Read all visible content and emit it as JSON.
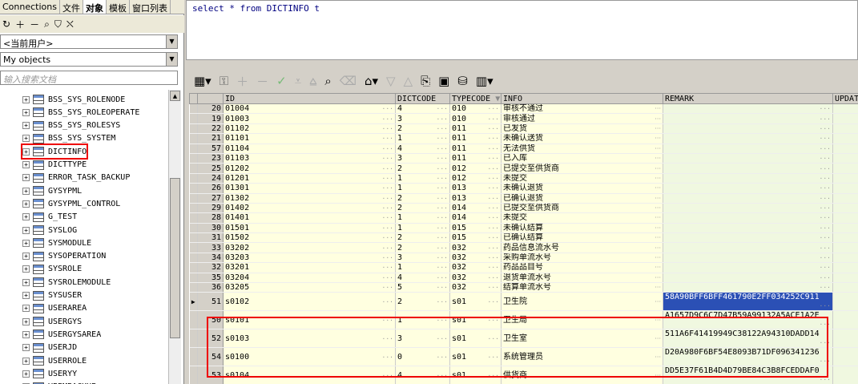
{
  "left_panel": {
    "tabs": [
      "Connections",
      "文件",
      "对象",
      "模板",
      "窗口列表"
    ],
    "active_tab": "对象",
    "user_select": "<当前用户>",
    "objects_select": "My objects",
    "search_placeholder": "输入搜索文档",
    "tree_items": [
      "BSS_SYS_ROLENODE",
      "BSS_SYS_ROLEOPERATE",
      "BSS_SYS_ROLESYS",
      "BSS_SYS_SYSTEM",
      "DICTINFO",
      "DICTTYPE",
      "ERROR_TASK_BACKUP",
      "GYSYPML",
      "GYSYPML_CONTROL",
      "G_TEST",
      "SYSLOG",
      "SYSMODULE",
      "SYSOPERATION",
      "SYSROLE",
      "SYSROLEMODULE",
      "SYSUSER",
      "USERAREA",
      "USERGYS",
      "USERGYSAREA",
      "USERJD",
      "USERROLE",
      "USERYY",
      "YPPMBACKUP"
    ],
    "selected_item": "DICTINFO"
  },
  "editor": {
    "sql": "select * from DICTINFO t"
  },
  "grid": {
    "columns": [
      "ID",
      "DICTCODE",
      "TYPECODE",
      "INFO",
      "REMARK",
      "UPDAT"
    ],
    "rows": [
      {
        "n": "20",
        "id": "01004",
        "dc": "4",
        "tc": "010",
        "info": "审核不通过",
        "remark": ""
      },
      {
        "n": "19",
        "id": "01003",
        "dc": "3",
        "tc": "010",
        "info": "审核通过",
        "remark": ""
      },
      {
        "n": "22",
        "id": "01102",
        "dc": "2",
        "tc": "011",
        "info": "已发货",
        "remark": ""
      },
      {
        "n": "21",
        "id": "01101",
        "dc": "1",
        "tc": "011",
        "info": "未确认送货",
        "remark": ""
      },
      {
        "n": "57",
        "id": "01104",
        "dc": "4",
        "tc": "011",
        "info": "无法供货",
        "remark": ""
      },
      {
        "n": "23",
        "id": "01103",
        "dc": "3",
        "tc": "011",
        "info": "已入库",
        "remark": ""
      },
      {
        "n": "25",
        "id": "01202",
        "dc": "2",
        "tc": "012",
        "info": "已提交至供货商",
        "remark": ""
      },
      {
        "n": "24",
        "id": "01201",
        "dc": "1",
        "tc": "012",
        "info": "未提交",
        "remark": ""
      },
      {
        "n": "26",
        "id": "01301",
        "dc": "1",
        "tc": "013",
        "info": "未确认退货",
        "remark": ""
      },
      {
        "n": "27",
        "id": "01302",
        "dc": "2",
        "tc": "013",
        "info": "已确认退货",
        "remark": ""
      },
      {
        "n": "29",
        "id": "01402",
        "dc": "2",
        "tc": "014",
        "info": "已提交至供货商",
        "remark": ""
      },
      {
        "n": "28",
        "id": "01401",
        "dc": "1",
        "tc": "014",
        "info": "未提交",
        "remark": ""
      },
      {
        "n": "30",
        "id": "01501",
        "dc": "1",
        "tc": "015",
        "info": "未确认结算",
        "remark": ""
      },
      {
        "n": "31",
        "id": "01502",
        "dc": "2",
        "tc": "015",
        "info": "已确认结算",
        "remark": ""
      },
      {
        "n": "33",
        "id": "03202",
        "dc": "2",
        "tc": "032",
        "info": "药品信息流水号",
        "remark": ""
      },
      {
        "n": "34",
        "id": "03203",
        "dc": "3",
        "tc": "032",
        "info": "采购单流水号",
        "remark": ""
      },
      {
        "n": "32",
        "id": "03201",
        "dc": "1",
        "tc": "032",
        "info": "药品品目号",
        "remark": ""
      },
      {
        "n": "35",
        "id": "03204",
        "dc": "4",
        "tc": "032",
        "info": "退货单流水号",
        "remark": ""
      },
      {
        "n": "36",
        "id": "03205",
        "dc": "5",
        "tc": "032",
        "info": "结算单流水号",
        "remark": ""
      },
      {
        "n": "51",
        "id": "s0102",
        "dc": "2",
        "tc": "s01",
        "info": "卫生院",
        "remark": "58A90BFF6BFF461790E2FF034252C911",
        "current": true
      },
      {
        "n": "50",
        "id": "s0101",
        "dc": "1",
        "tc": "s01",
        "info": "卫生局",
        "remark": "A1657D9C6C7D47B59A99132A5ACE1A2E"
      },
      {
        "n": "52",
        "id": "s0103",
        "dc": "3",
        "tc": "s01",
        "info": "卫生室",
        "remark": "511A6F41419949C38122A94310DADD14"
      },
      {
        "n": "54",
        "id": "s0100",
        "dc": "0",
        "tc": "s01",
        "info": "系统管理员",
        "remark": "D20A980F6BF54E8093B71DF096341236"
      },
      {
        "n": "53",
        "id": "s0104",
        "dc": "4",
        "tc": "s01",
        "info": "供货商",
        "remark": "DD5E37F61B4D4D79BE84C3B8FCEDDAF0"
      }
    ]
  }
}
